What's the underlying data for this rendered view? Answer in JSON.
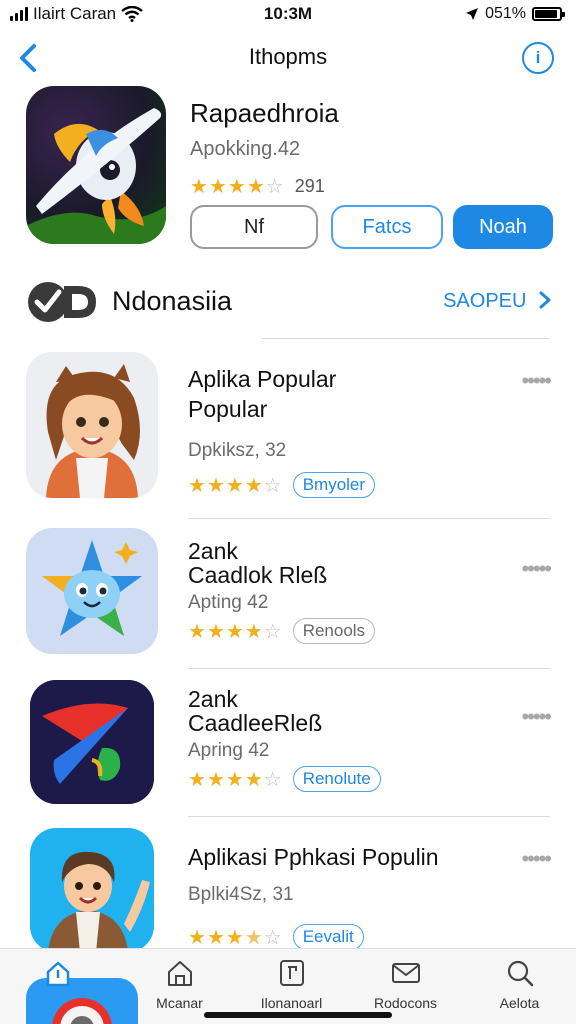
{
  "status_bar": {
    "carrier": "Ilairt Caran",
    "time": "10:3M",
    "battery_percent": "051%",
    "battery_level": 0.9
  },
  "nav": {
    "title": "Ithopms",
    "info_label": "i",
    "icons": {
      "back": "chevron-left-icon",
      "info": "info-icon"
    }
  },
  "featured": {
    "name": "Rapaedhroia",
    "subtitle": "Apokking.42",
    "rating": 4,
    "rating_count": "291",
    "buttons": [
      "Nf",
      "Fatcs",
      "Noah"
    ]
  },
  "section": {
    "title": "Ndonasiia",
    "link": "SAOPEU",
    "link_icon": "chevron-right-icon"
  },
  "apps": [
    {
      "title_line1": "Aplika Popular",
      "title_line2": "Popular",
      "subtitle": "Dpkiksz, 32",
      "rating": 4,
      "badge": "Bmyoler",
      "badge_style": "blue",
      "more": "•••••"
    },
    {
      "title_line1": "2ank",
      "title_line2": "Caadlok Rleß",
      "subtitle": "Apting 42",
      "rating": 4,
      "badge": "Renools",
      "badge_style": "gray",
      "more": "•••••"
    },
    {
      "title_line1": "2ank",
      "title_line2": "CaadleeRleß",
      "subtitle": "Apring 42",
      "rating": 4,
      "badge": "Renolute",
      "badge_style": "blue",
      "more": "•••••"
    },
    {
      "title_line1": "Aplikasi Pphkasi Populin",
      "title_line2": "",
      "subtitle": "Bplki4Sz, 31",
      "rating": 3.5,
      "badge": "Eevalit",
      "badge_style": "blue",
      "more": "•••••"
    }
  ],
  "tabbar": {
    "tabs": [
      {
        "label": "",
        "icon": "home-icon"
      },
      {
        "label": "Mcanar",
        "icon": "house-icon"
      },
      {
        "label": "Ilonanoarl",
        "icon": "document-icon"
      },
      {
        "label": "Rodocons",
        "icon": "mail-icon"
      },
      {
        "label": "Aelota",
        "icon": "search-icon"
      }
    ]
  },
  "colors": {
    "accent": "#1e88e5",
    "star": "#f2b01e",
    "divider": "#d8d8d8"
  }
}
